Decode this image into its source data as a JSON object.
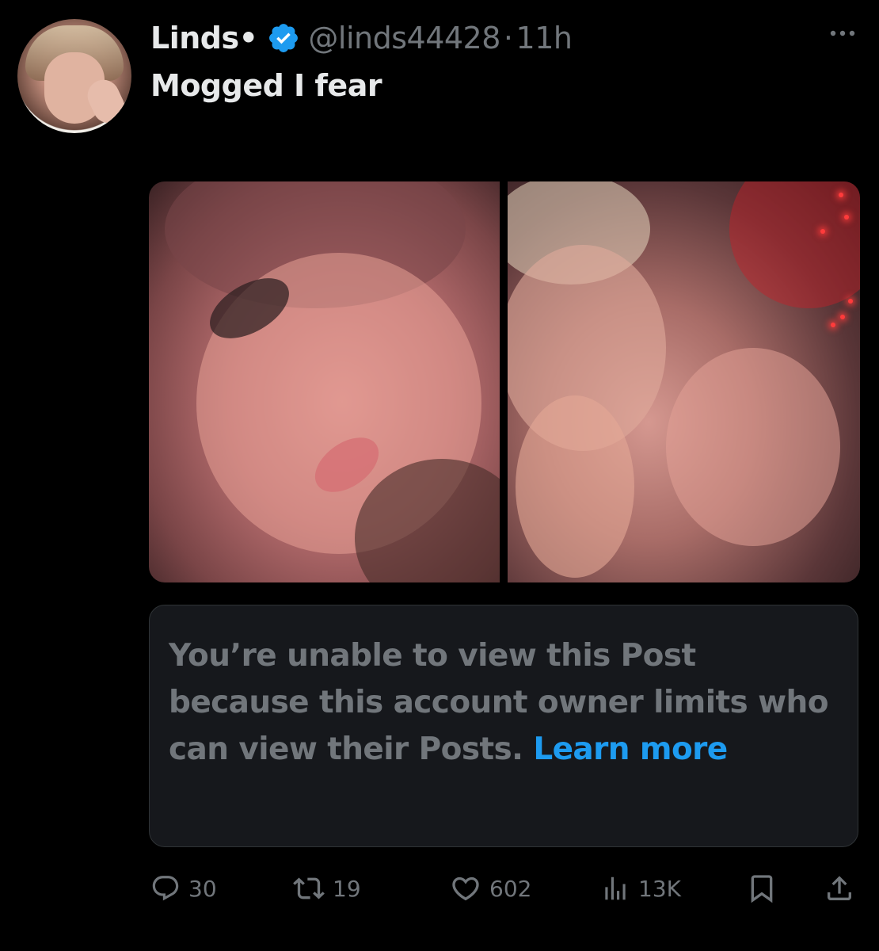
{
  "author": {
    "display_name": "Linds•",
    "handle": "@linds44428",
    "separator": "·",
    "time": "11h",
    "verified": true
  },
  "post": {
    "text": "Mogged I fear"
  },
  "notice": {
    "text": "You’re unable to view this Post because this account owner limits who can view their Posts. ",
    "link_label": "Learn more"
  },
  "actions": {
    "replies": "30",
    "reposts": "19",
    "likes": "602",
    "views": "13K"
  },
  "icons": {
    "verified": "verified-badge-icon",
    "more": "more-options-icon",
    "reply": "reply-icon",
    "repost": "repost-icon",
    "like": "heart-icon",
    "views": "views-chart-icon",
    "bookmark": "bookmark-icon",
    "share": "share-icon"
  },
  "colors": {
    "background": "#000000",
    "text_primary": "#e7e9ea",
    "text_secondary": "#71767b",
    "accent": "#1d9bf0",
    "notice_background": "#16181c"
  }
}
